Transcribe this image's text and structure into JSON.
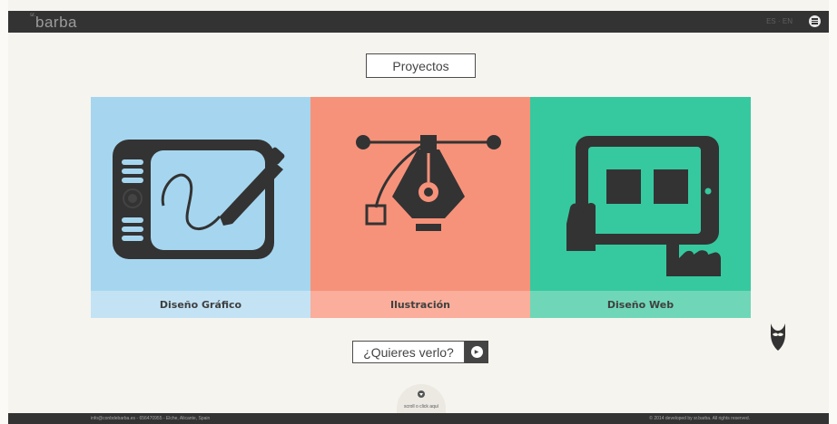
{
  "header": {
    "logo_prefix": "sr.",
    "logo_text": "barba",
    "lang_es": "ES",
    "lang_separator": "·",
    "lang_en": "EN",
    "menu_icon": "hamburger-icon"
  },
  "main": {
    "title": "Proyectos",
    "cards": [
      {
        "label": "Diseño Gráfico",
        "icon": "drawing-tablet-icon",
        "color": "#a6d6ef"
      },
      {
        "label": "Ilustración",
        "icon": "pen-tool-icon",
        "color": "#f7927a"
      },
      {
        "label": "Diseño Web",
        "icon": "tablet-touch-icon",
        "color": "#36c99f"
      }
    ],
    "cta_label": "¿Quieres verlo?",
    "cta_icon": "arrow-right-icon",
    "scroll_label": "scroll o click aquí",
    "scroll_icon": "chevron-down-icon",
    "mascot_icon": "beard-icon"
  },
  "footer": {
    "contact": "info@conbdebarba.es - 656470955 - Elche, Alicante, Spain",
    "copyright": "© 2014 developed by sr.barba. All rights reserved."
  },
  "colors": {
    "bar": "#333333",
    "background": "#f6f4ef",
    "blue": "#a6d6ef",
    "salmon": "#f7927a",
    "green": "#36c99f"
  }
}
